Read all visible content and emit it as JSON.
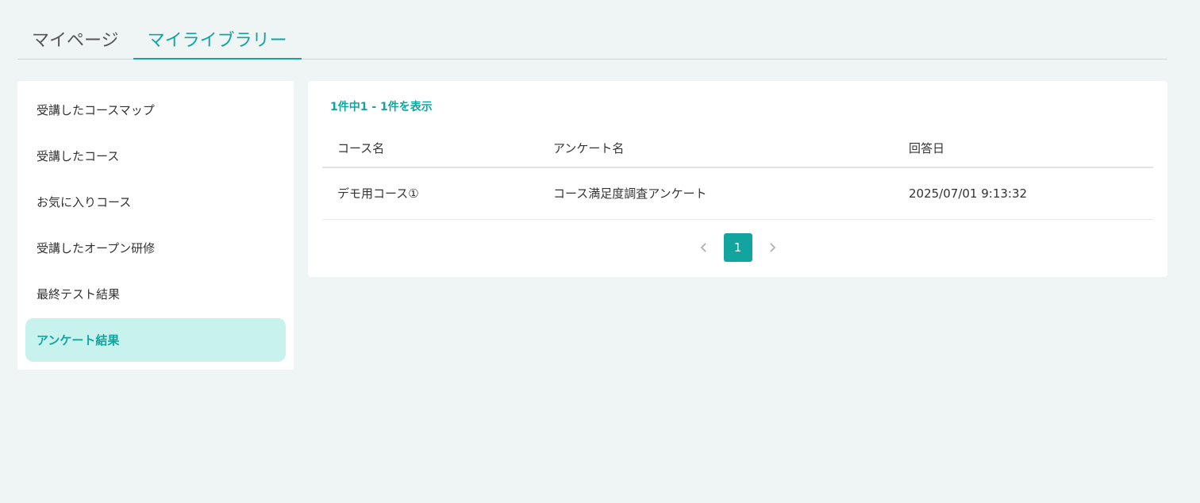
{
  "tabs": [
    {
      "label": "マイページ",
      "active": false
    },
    {
      "label": "マイライブラリー",
      "active": true
    }
  ],
  "sidebar": {
    "items": [
      {
        "label": "受講したコースマップ"
      },
      {
        "label": "受講したコース"
      },
      {
        "label": "お気に入りコース"
      },
      {
        "label": "受講したオープン研修"
      },
      {
        "label": "最終テスト結果"
      },
      {
        "label": "アンケート結果"
      }
    ],
    "active_index": 5
  },
  "main": {
    "count_text": "1件中1 - 1件を表示",
    "table": {
      "headers": [
        "コース名",
        "アンケート名",
        "回答日"
      ],
      "rows": [
        [
          "デモ用コース①",
          "コース満足度調査アンケート",
          "2025/07/01 9:13:32"
        ]
      ]
    },
    "pagination": {
      "prev_icon": "chevron-left-icon",
      "current_page": "1",
      "next_icon": "chevron-right-icon"
    }
  },
  "colors": {
    "accent": "#12a5a0",
    "active_bg": "#c8f2ee",
    "page_bg": "#eff5f4"
  }
}
